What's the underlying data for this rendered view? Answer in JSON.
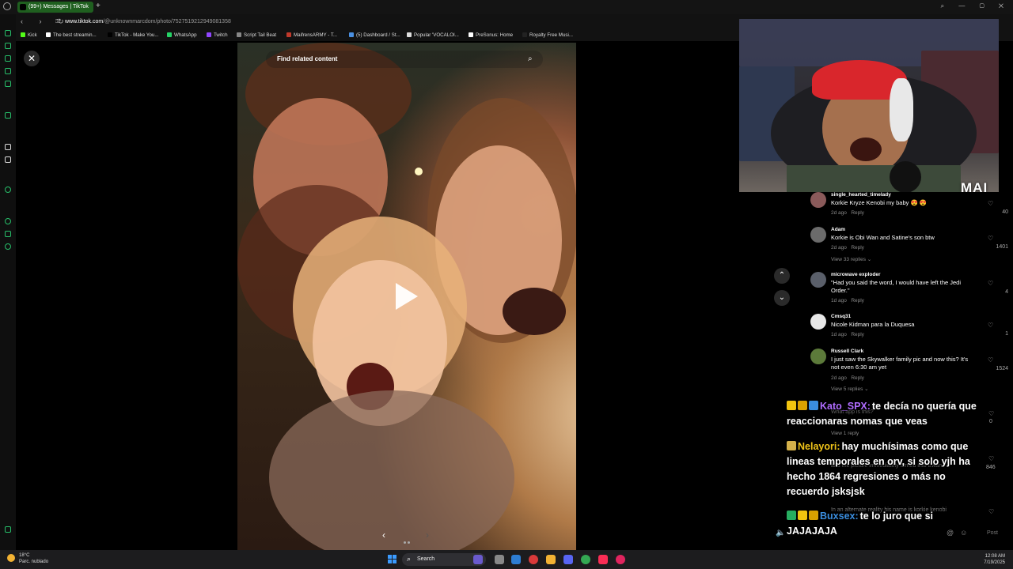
{
  "browser": {
    "tab_title": "(99+) Messages | TikTok",
    "new_tab": "+",
    "url_host": "www.tiktok.com",
    "url_path": "/@unknownmarcdom/photo/7527519212949081358"
  },
  "bookmarks": [
    {
      "label": "Kick",
      "color": "#53fc18"
    },
    {
      "label": "The best streamin...",
      "color": "#ffffff"
    },
    {
      "label": "TikTok - Make You...",
      "color": "#000000"
    },
    {
      "label": "WhatsApp",
      "color": "#25d366"
    },
    {
      "label": "Twitch",
      "color": "#9146ff"
    },
    {
      "label": "Script Tail Beat",
      "color": "#888888"
    },
    {
      "label": "MaifrensARMY - T...",
      "color": "#c0392b"
    },
    {
      "label": "(5) Dashboard / St...",
      "color": "#4a90e2"
    },
    {
      "label": "Popular 'VOCALOI...",
      "color": "#dddddd"
    },
    {
      "label": "PreSonus: Home",
      "color": "#ffffff"
    },
    {
      "label": "Royalty Free Musi...",
      "color": "#222222"
    }
  ],
  "viewer": {
    "search_placeholder": "Find related content",
    "close_icon": "close-icon",
    "play_icon": "play-icon"
  },
  "comments": [
    {
      "user": "single_hearted_timelady",
      "text": "Korkie Kryze Kenobi my baby 😍 😍",
      "time": "2d ago",
      "reply": "Reply",
      "likes": "40",
      "avatar_color": "#8a5a5a"
    },
    {
      "user": "Adam",
      "text": "Korkie is Obi Wan and Satine's son btw",
      "time": "2d ago",
      "reply": "Reply",
      "likes": "1401",
      "replies": "View 33 replies",
      "avatar_color": "#6b6b6b"
    },
    {
      "user": "microwave exploder",
      "text": "\"Had you said the word, I would have left the Jedi Order.\"",
      "time": "1d ago",
      "reply": "Reply",
      "likes": "4",
      "avatar_color": "#5a5f6a"
    },
    {
      "user": "Cmsq31",
      "text": "Nicole Kidman para la Duquesa",
      "time": "1d ago",
      "reply": "Reply",
      "likes": "1",
      "avatar_color": "#e8e8e8"
    },
    {
      "user": "Russell Clark",
      "text": "I just saw the Skywalker family pic and now this? It's not even 6:30 am yet",
      "time": "2d ago",
      "reply": "Reply",
      "likes": "1524",
      "replies": "View 5 replies",
      "avatar_color": "#5c7a3a"
    }
  ],
  "hidden_comments": {
    "c1_text": "What app is this?",
    "c1_likes": "0",
    "c1_replies": "View 1 reply",
    "c2_text": "and the picture immediately turned into Ewan",
    "c2_likes": "846",
    "c3_text": "In an alternate reality his name is korkie kenobi"
  },
  "chat": [
    {
      "name": "Kato_SPX:",
      "name_color": "#b06cff",
      "message": "te decía no quería que reaccionaras nomas que veas",
      "badges": [
        "#f1c40f",
        "#d9a200",
        "#3a8dde"
      ]
    },
    {
      "name": "Nelayori:",
      "name_color": "#f0c419",
      "message": "hay muchísimas como que lineas temporales en orv, si solo yjh ha hecho 1864 regresiones o más no recuerdo jsksjsk",
      "badges": [
        "#d4b04a"
      ]
    },
    {
      "name": "Buxsex:",
      "name_color": "#3a8dde",
      "message": "te lo juro que si JAJAJAJA",
      "badges": [
        "#27ae60",
        "#f1c40f",
        "#d9a200"
      ]
    }
  ],
  "comment_bar": {
    "post_label": "Post"
  },
  "webcam": {
    "logo": "MAI"
  },
  "taskbar": {
    "temperature": "18°C",
    "weather": "Parc. nublado",
    "search_label": "Search",
    "time": "12:08 AM",
    "date": "7/19/2025"
  }
}
